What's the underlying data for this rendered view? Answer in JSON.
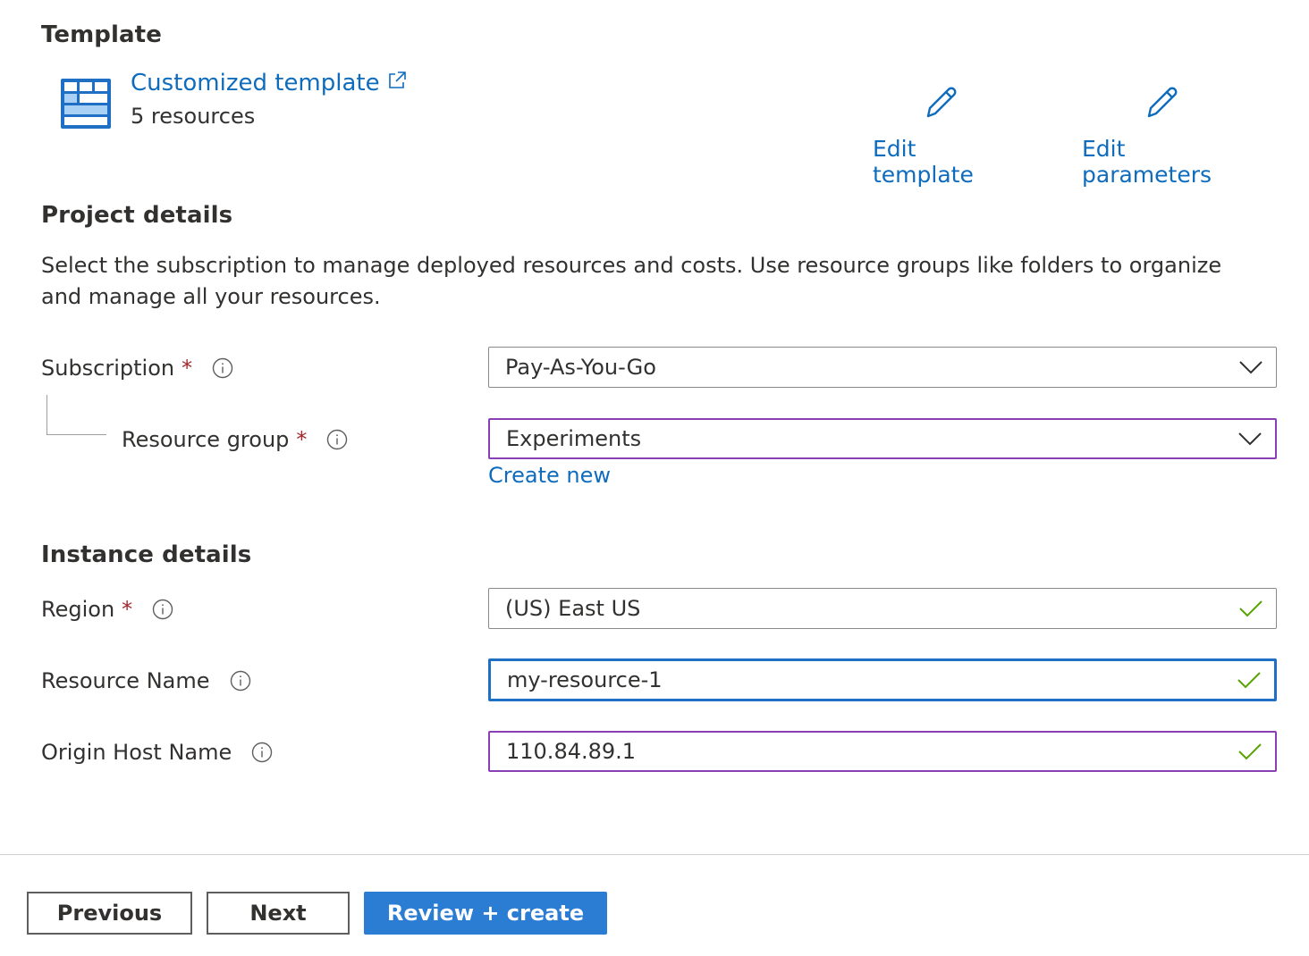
{
  "template": {
    "section_title": "Template",
    "link_label": "Customized template",
    "resource_count": "5 resources",
    "edit_template_label": "Edit template",
    "edit_parameters_label": "Edit parameters"
  },
  "project": {
    "section_title": "Project details",
    "description": "Select the subscription to manage deployed resources and costs. Use resource groups like folders to organize and manage all your resources.",
    "subscription_label": "Subscription",
    "subscription_value": "Pay-As-You-Go",
    "resource_group_label": "Resource group",
    "resource_group_value": "Experiments",
    "create_new_label": "Create new"
  },
  "instance": {
    "section_title": "Instance details",
    "region_label": "Region",
    "region_value": "(US) East US",
    "resource_name_label": "Resource Name",
    "resource_name_value": "my-resource-1",
    "origin_host_label": "Origin Host Name",
    "origin_host_value": "110.84.89.1"
  },
  "required_marker": "*",
  "footer": {
    "previous_label": "Previous",
    "next_label": "Next",
    "review_create_label": "Review + create"
  },
  "colors": {
    "link": "#0f6cbd",
    "primary_button": "#2b7cd3",
    "required": "#a4262c",
    "valid_check": "#57a300",
    "focus_border": "#1f6fc5",
    "dirty_border": "#8a3fb5"
  },
  "icons": {
    "template": "template-grid-icon",
    "external_link": "external-link-icon",
    "edit": "pencil-icon",
    "info": "info-icon",
    "dropdown": "chevron-down-icon",
    "valid": "checkmark-icon"
  }
}
